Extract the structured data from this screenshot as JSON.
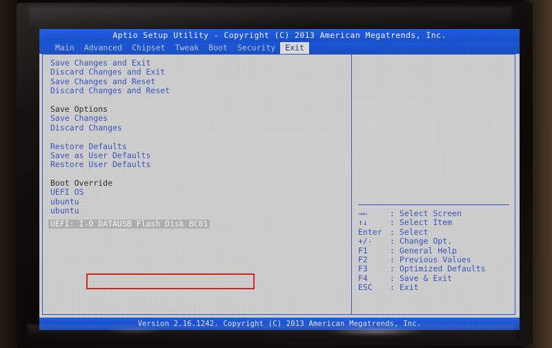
{
  "bios": {
    "title": "Aptio Setup Utility - Copyright (C) 2013 American Megatrends, Inc.",
    "footer": "Version 2.16.1242. Copyright (C) 2013 American Megatrends, Inc.",
    "tabs": [
      {
        "label": "Main",
        "active": false
      },
      {
        "label": "Advanced",
        "active": false
      },
      {
        "label": "Chipset",
        "active": false
      },
      {
        "label": "Tweak",
        "active": false
      },
      {
        "label": "Boot",
        "active": false
      },
      {
        "label": "Security",
        "active": false
      },
      {
        "label": "Exit",
        "active": true
      }
    ],
    "menu": [
      {
        "label": "Save Changes and Exit",
        "kind": "item"
      },
      {
        "label": "Discard Changes and Exit",
        "kind": "item"
      },
      {
        "label": "Save Changes and Reset",
        "kind": "item"
      },
      {
        "label": "Discard Changes and Reset",
        "kind": "item"
      },
      {
        "label": " ",
        "kind": "spacer"
      },
      {
        "label": "Save Options",
        "kind": "header"
      },
      {
        "label": "Save Changes",
        "kind": "item"
      },
      {
        "label": "Discard Changes",
        "kind": "item"
      },
      {
        "label": " ",
        "kind": "spacer"
      },
      {
        "label": "Restore Defaults",
        "kind": "item"
      },
      {
        "label": "Save as User Defaults",
        "kind": "item"
      },
      {
        "label": "Restore User Defaults",
        "kind": "item"
      },
      {
        "label": " ",
        "kind": "spacer"
      },
      {
        "label": "Boot Override",
        "kind": "header"
      },
      {
        "label": "UEFI OS",
        "kind": "item"
      },
      {
        "label": "ubuntu",
        "kind": "item"
      },
      {
        "label": "ubuntu",
        "kind": "item"
      },
      {
        "label": "UEFI: I-O DATAUSB Flash Disk BC01",
        "kind": "highlight"
      }
    ],
    "help_keys": [
      {
        "key": "→←",
        "sep": ":",
        "action": "Select Screen"
      },
      {
        "key": "↑↓",
        "sep": ":",
        "action": "Select Item"
      },
      {
        "key": "Enter",
        "sep": ":",
        "action": "Select"
      },
      {
        "key": "+/-",
        "sep": ":",
        "action": "Change Opt."
      },
      {
        "key": "F1",
        "sep": ":",
        "action": "General Help"
      },
      {
        "key": "F2",
        "sep": ":",
        "action": "Previous Values"
      },
      {
        "key": "F3",
        "sep": ":",
        "action": "Optimized Defaults"
      },
      {
        "key": "F4",
        "sep": ":",
        "action": "Save & Exit"
      },
      {
        "key": "ESC",
        "sep": ":",
        "action": "Exit"
      }
    ],
    "annotation": {
      "kind": "red-rectangle-highlight",
      "target": "UEFI: I-O DATAUSB Flash Disk BC01",
      "color": "#e41414"
    },
    "colors": {
      "title_bar": "#0d4fdc",
      "panel_bg": "#d2d2d2",
      "menu_text": "#2b49c4",
      "header_text": "#1d1d1d",
      "selection_bg": "#b0b0b0",
      "selection_text": "#ffffff",
      "border": "#1a4fd0"
    }
  }
}
